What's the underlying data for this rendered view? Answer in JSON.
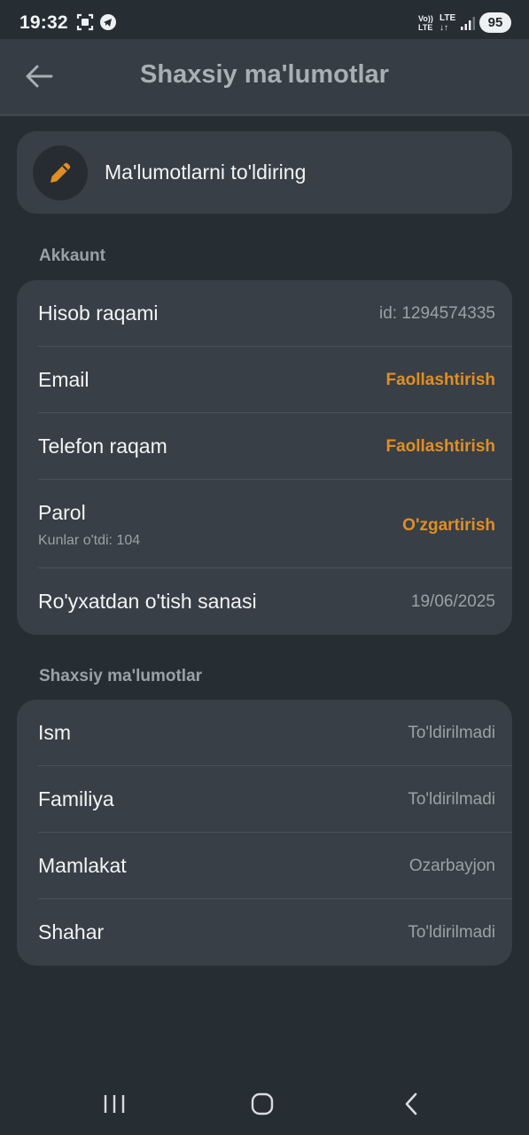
{
  "status": {
    "time": "19:32",
    "network_label_top": "Vo))",
    "network_label_bottom": "LTE",
    "lte_top": "LTE",
    "battery": "95"
  },
  "header": {
    "title": "Shaxsiy ma'lumotlar",
    "back_icon": "arrow-left-icon"
  },
  "fill_card": {
    "label": "Ma'lumotlarni to'ldiring",
    "icon": "pencil-icon",
    "accent": "#e08e25"
  },
  "account": {
    "section_label": "Akkaunt",
    "rows": [
      {
        "label": "Hisob raqami",
        "value": "id: 1294574335"
      },
      {
        "label": "Email",
        "value": "Faollashtirish"
      },
      {
        "label": "Telefon raqam",
        "value": "Faollashtirish"
      },
      {
        "label": "Parol",
        "sub": "Kunlar o'tdi: 104",
        "value": "O'zgartirish"
      },
      {
        "label": "Ro'yxatdan o'tish sanasi",
        "value": "19/06/2025"
      }
    ]
  },
  "personal": {
    "section_label": "Shaxsiy ma'lumotlar",
    "rows": [
      {
        "label": "Ism",
        "value": "To'ldirilmadi"
      },
      {
        "label": "Familiya",
        "value": "To'ldirilmadi"
      },
      {
        "label": "Mamlakat",
        "value": "Ozarbayjon"
      },
      {
        "label": "Shahar",
        "value": "To'ldirilmadi"
      }
    ]
  },
  "nav": {
    "recents_icon": "recents-icon",
    "home_icon": "home-icon",
    "back_icon": "back-chevron-icon"
  },
  "colors": {
    "background": "#262d33",
    "card": "#383f46",
    "accent": "#e08e25",
    "muted": "#9aa2a8"
  }
}
